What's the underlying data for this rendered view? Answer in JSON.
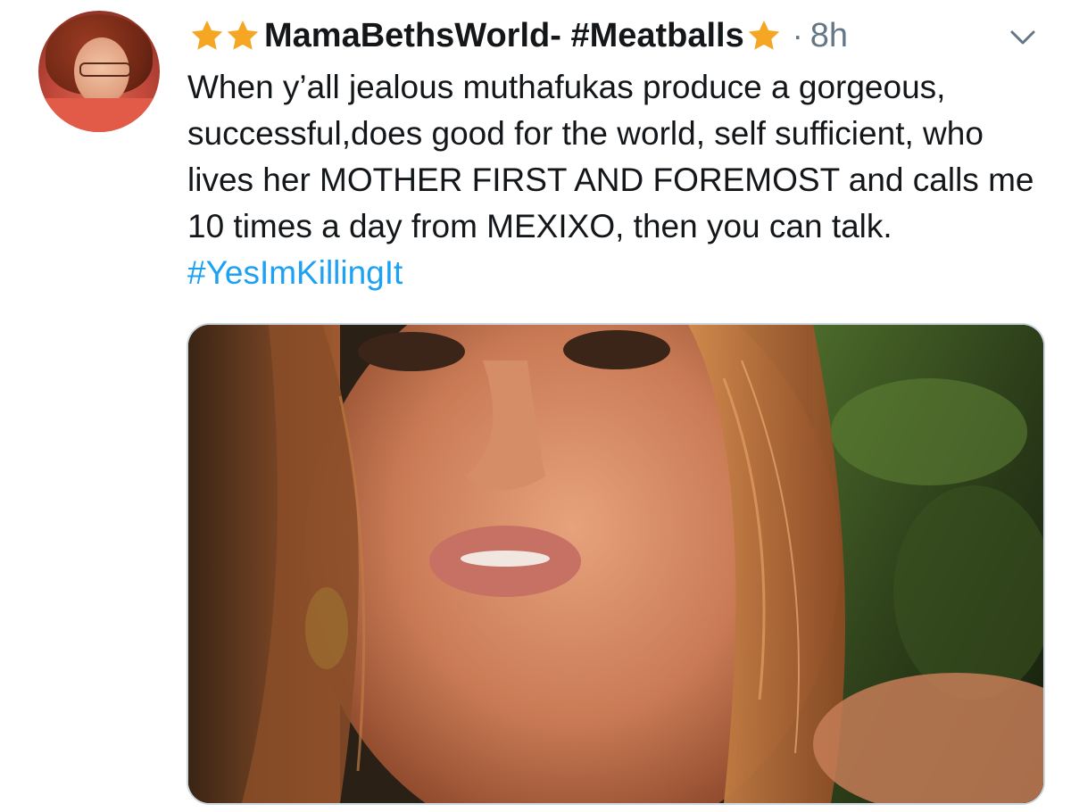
{
  "colors": {
    "star": "#f5a623",
    "text": "#14171a",
    "secondary": "#657786",
    "link": "#1da1f2",
    "media_border": "#ccd6dd"
  },
  "tweet": {
    "display_name": "MamaBethsWorld- #Meatballs",
    "separator": "·",
    "timestamp": "8h",
    "leading_star_icons": [
      "star-icon",
      "star-icon"
    ],
    "trailing_star_icons": [
      "star-icon"
    ],
    "menu_icon": "chevron-down-icon",
    "body_text": "When y’all jealous muthafukas produce a gorgeous, successful,does good for the world, self sufficient, who lives her MOTHER FIRST AND FOREMOST and calls me 10 times a day from MEXIXO, then you can talk.",
    "hashtag": "#YesImKillingIt",
    "media_icon": "photo-icon"
  }
}
